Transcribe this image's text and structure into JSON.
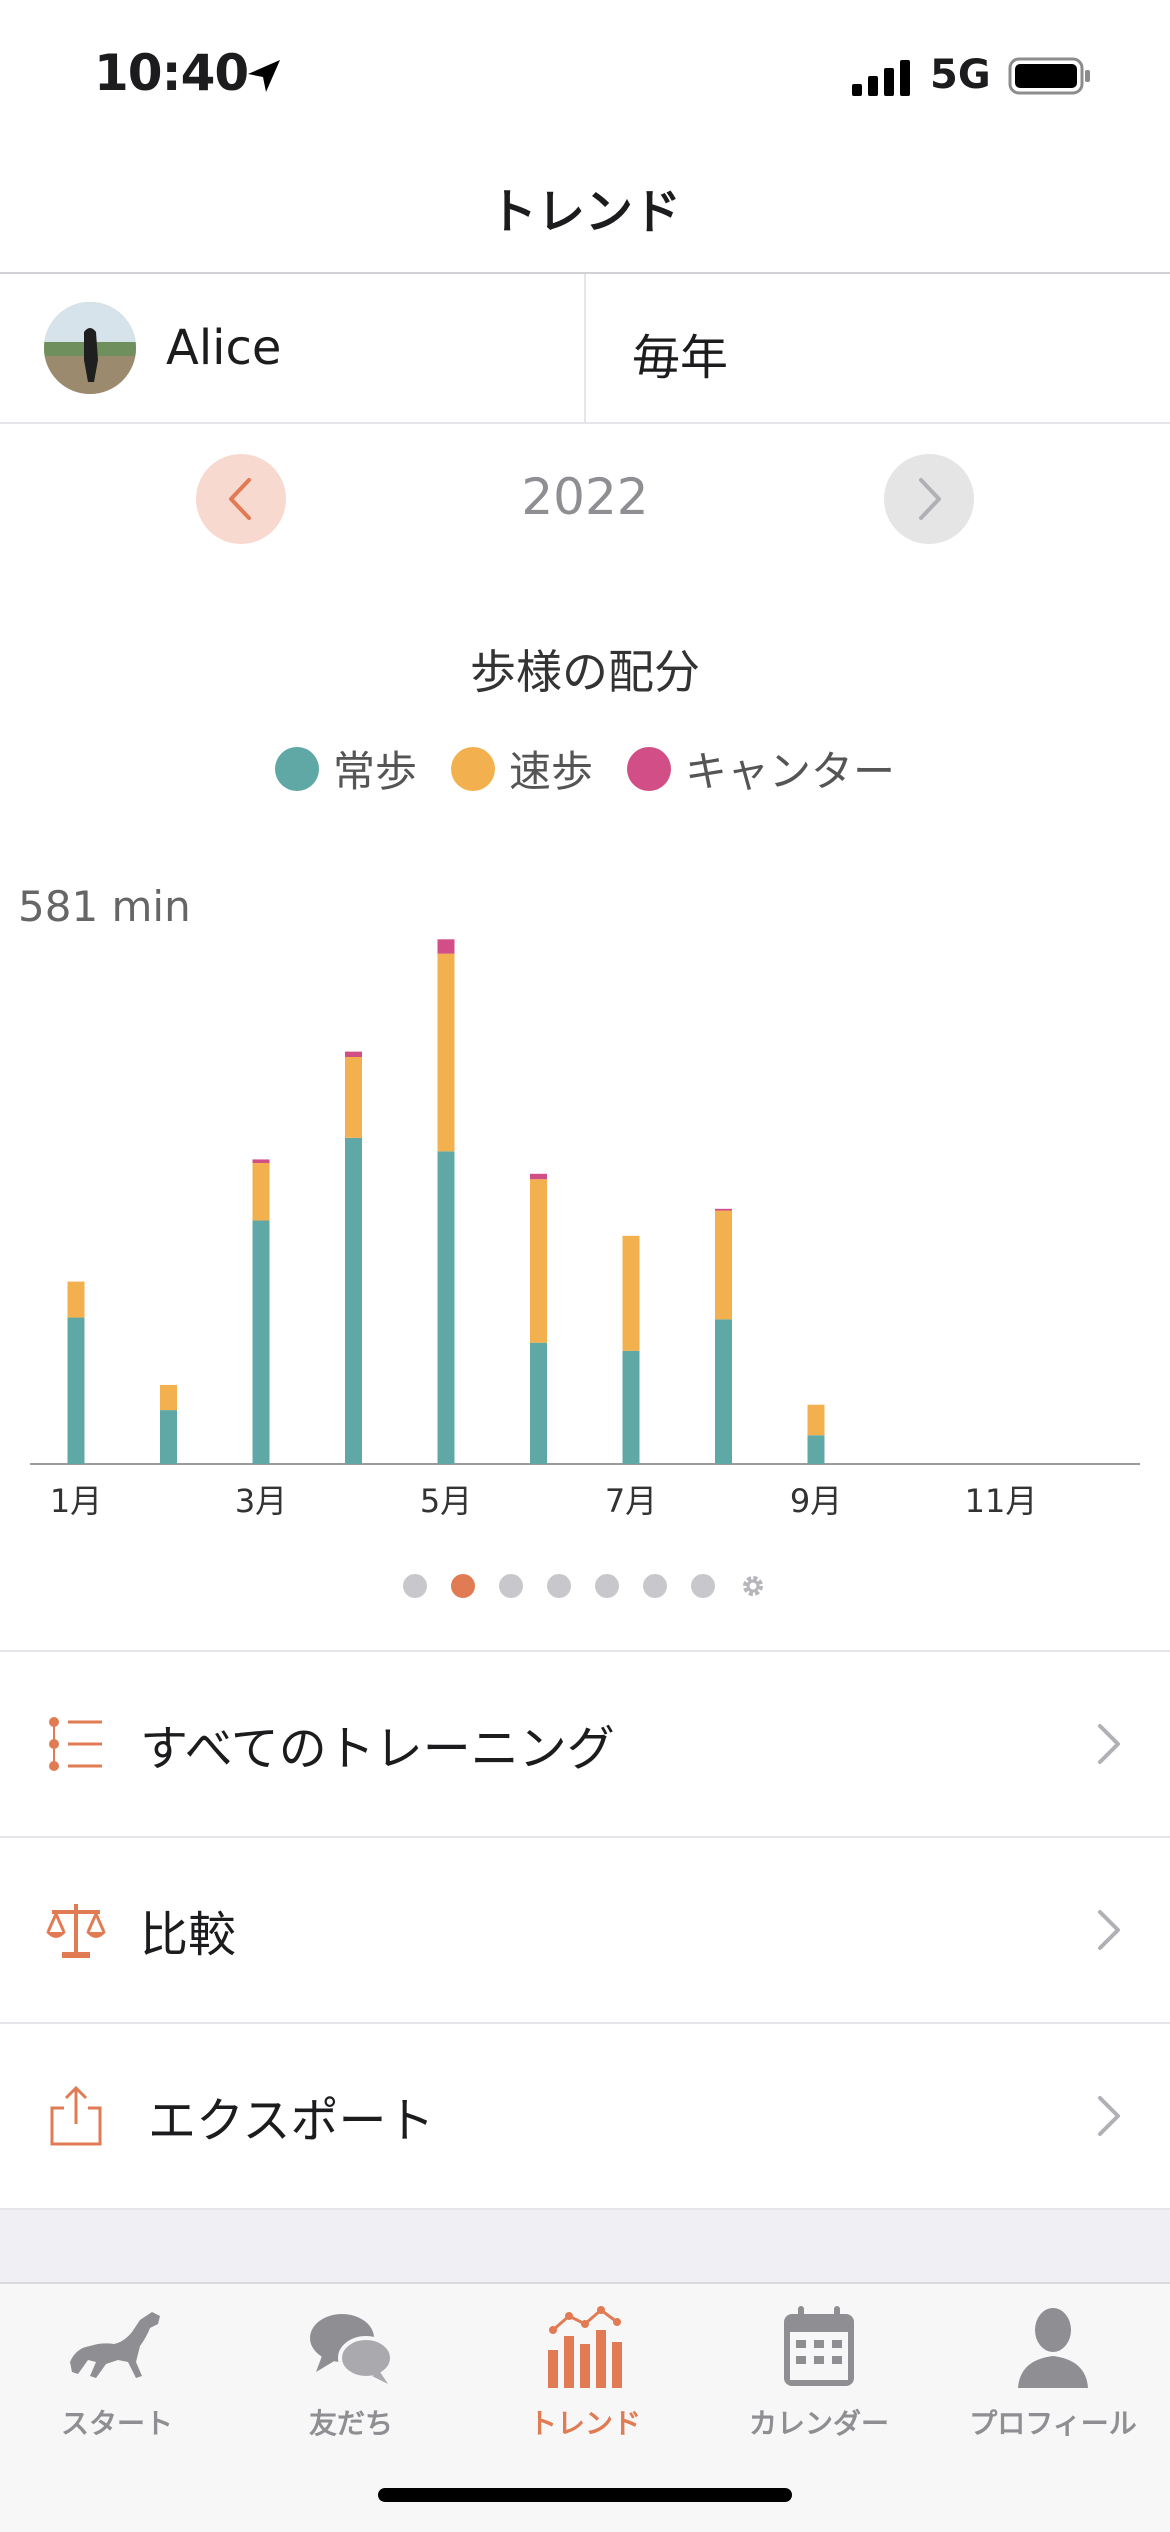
{
  "status_bar": {
    "time": "10:40",
    "network": "5G"
  },
  "header": {
    "title": "トレンド"
  },
  "selector": {
    "horse_name": "Alice",
    "period": "毎年"
  },
  "year_nav": {
    "year": "2022"
  },
  "chart": {
    "title": "歩様の配分",
    "legend": [
      {
        "label": "常歩",
        "color": "#5fa8a5"
      },
      {
        "label": "速歩",
        "color": "#f2b04e"
      },
      {
        "label": "キャンター",
        "color": "#d14f86"
      }
    ],
    "y_max_label": "581 min",
    "x_tick_labels": [
      "1月",
      "3月",
      "5月",
      "7月",
      "9月",
      "11月"
    ]
  },
  "chart_data": {
    "type": "bar",
    "stacked": true,
    "categories": [
      "1月",
      "2月",
      "3月",
      "4月",
      "5月",
      "6月",
      "7月",
      "8月",
      "9月",
      "10月",
      "11月",
      "12月"
    ],
    "series": [
      {
        "name": "常歩",
        "color": "#5fa8a5",
        "values": [
          163,
          60,
          271,
          363,
          348,
          135,
          126,
          161,
          32,
          0,
          0,
          0
        ]
      },
      {
        "name": "速歩",
        "color": "#f2b04e",
        "values": [
          40,
          28,
          64,
          90,
          220,
          182,
          128,
          121,
          34,
          0,
          0,
          0
        ]
      },
      {
        "name": "キャンター",
        "color": "#d14f86",
        "values": [
          0,
          0,
          4,
          6,
          16,
          6,
          0,
          2,
          0,
          0,
          0,
          0
        ]
      }
    ],
    "ylim": [
      0,
      581
    ],
    "y_max_label": "581 min",
    "grid": false
  },
  "pagination": {
    "count": 7,
    "active_index": 1
  },
  "menu": [
    {
      "label": "すべてのトレーニング",
      "icon": "list-icon"
    },
    {
      "label": "比較",
      "icon": "scale-icon"
    },
    {
      "label": "エクスポート",
      "icon": "share-icon"
    }
  ],
  "tabs": [
    {
      "label": "スタート",
      "icon": "horse-icon",
      "active": false
    },
    {
      "label": "友だち",
      "icon": "chat-bubbles-icon",
      "active": false
    },
    {
      "label": "トレンド",
      "icon": "bar-chart-icon",
      "active": true
    },
    {
      "label": "カレンダー",
      "icon": "calendar-icon",
      "active": false
    },
    {
      "label": "プロフィール",
      "icon": "person-icon",
      "active": false
    }
  ],
  "colors": {
    "accent": "#e07b54",
    "walk": "#5fa8a5",
    "trot": "#f2b04e",
    "canter": "#d14f86"
  }
}
